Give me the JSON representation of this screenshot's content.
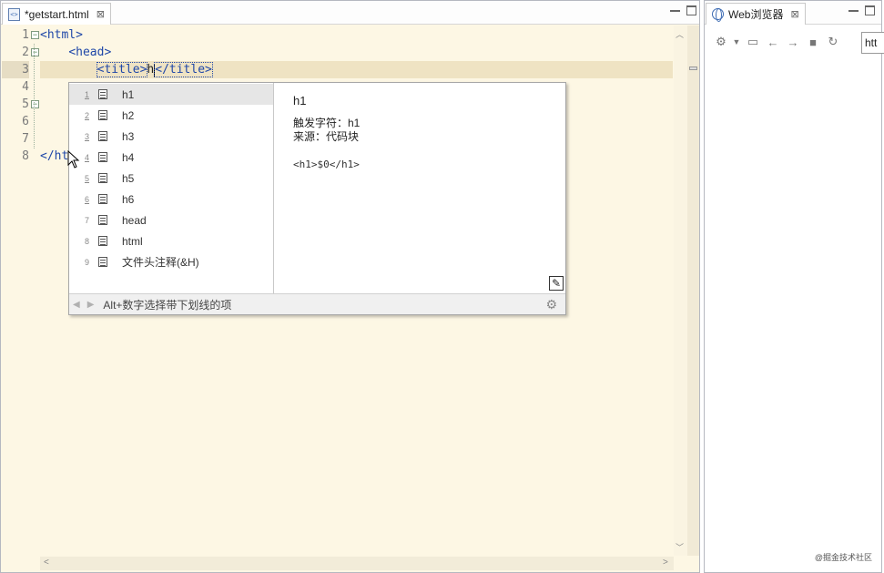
{
  "editor": {
    "tab_title": "*getstart.html",
    "file_icon_glyph": "<>",
    "close_glyph": "⊠",
    "line_numbers": [
      "1",
      "2",
      "3",
      "4",
      "5",
      "6",
      "7",
      "8"
    ],
    "code_lines": [
      {
        "indent": "",
        "tag_open": "<html>",
        "text": "",
        "tag_close": ""
      },
      {
        "indent": "    ",
        "tag_open": "<head>",
        "text": "",
        "tag_close": ""
      },
      {
        "indent": "        ",
        "tag_open": "<title>",
        "text": "h",
        "tag_close": "</title>"
      },
      {
        "indent": "",
        "tag_open": "",
        "text": "",
        "tag_close": ""
      },
      {
        "indent": "",
        "tag_open": "",
        "text": "",
        "tag_close": ""
      },
      {
        "indent": "",
        "tag_open": "",
        "text": "",
        "tag_close": ""
      },
      {
        "indent": "",
        "tag_open": "",
        "text": "",
        "tag_close": ""
      },
      {
        "indent": "",
        "tag_open": "</ht",
        "text": "",
        "tag_close": ""
      }
    ],
    "active_line": 3
  },
  "assist": {
    "items": [
      {
        "num": "1",
        "label": "h1",
        "underlined": true
      },
      {
        "num": "2",
        "label": "h2",
        "underlined": true
      },
      {
        "num": "3",
        "label": "h3",
        "underlined": true
      },
      {
        "num": "4",
        "label": "h4",
        "underlined": true
      },
      {
        "num": "5",
        "label": "h5",
        "underlined": true
      },
      {
        "num": "6",
        "label": "h6",
        "underlined": true
      },
      {
        "num": "7",
        "label": "head",
        "underlined": false
      },
      {
        "num": "8",
        "label": "html",
        "underlined": false
      },
      {
        "num": "9",
        "label": "文件头注释(&H)",
        "underlined": false
      }
    ],
    "selected_index": 0,
    "detail": {
      "title": "h1",
      "trigger": "触发字符：h1",
      "source": "来源：代码块",
      "snippet": "<h1>$0</h1>"
    },
    "status_text": "Alt+数字选择带下划线的项"
  },
  "browser": {
    "tab_title": "Web浏览器",
    "url_text": "htt",
    "watermark": "@掘金技术社区"
  },
  "colors": {
    "editor_bg": "#fdf7e4",
    "tag_color": "#1f47a8",
    "active_line": "#efe3c3"
  }
}
